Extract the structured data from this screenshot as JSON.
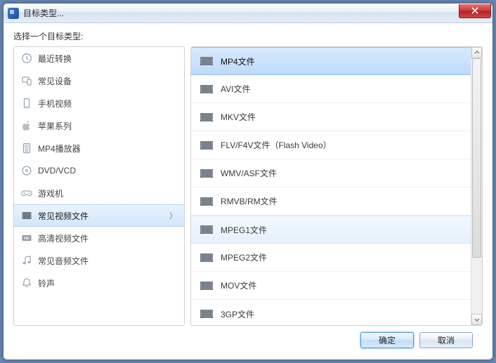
{
  "window": {
    "title": "目标类型..."
  },
  "prompt": "选择一个目标类型:",
  "categories": [
    {
      "id": "recent",
      "label": "最近转换",
      "icon": "clock"
    },
    {
      "id": "devices",
      "label": "常见设备",
      "icon": "device"
    },
    {
      "id": "mobile",
      "label": "手机视频",
      "icon": "phone"
    },
    {
      "id": "apple",
      "label": "苹果系列",
      "icon": "apple"
    },
    {
      "id": "mp4played",
      "label": "MP4播放器",
      "icon": "mp4player"
    },
    {
      "id": "dvdvcd",
      "label": "DVD/VCD",
      "icon": "disc"
    },
    {
      "id": "console",
      "label": "游戏机",
      "icon": "gamepad"
    },
    {
      "id": "video",
      "label": "常见视频文件",
      "icon": "film",
      "selected": true
    },
    {
      "id": "hd",
      "label": "高清视频文件",
      "icon": "hd"
    },
    {
      "id": "audio",
      "label": "常见音频文件",
      "icon": "music"
    },
    {
      "id": "ringtone",
      "label": "铃声",
      "icon": "bell"
    }
  ],
  "formats": [
    {
      "label": "MP4文件",
      "selected": true
    },
    {
      "label": "AVI文件"
    },
    {
      "label": "MKV文件"
    },
    {
      "label": "FLV/F4V文件（Flash Video）"
    },
    {
      "label": "WMV/ASF文件"
    },
    {
      "label": "RMVB/RM文件"
    },
    {
      "label": "MPEG1文件",
      "hover": true
    },
    {
      "label": "MPEG2文件"
    },
    {
      "label": "MOV文件"
    },
    {
      "label": "3GP文件"
    }
  ],
  "buttons": {
    "ok": "确定",
    "cancel": "取消"
  },
  "chevron": "〉"
}
